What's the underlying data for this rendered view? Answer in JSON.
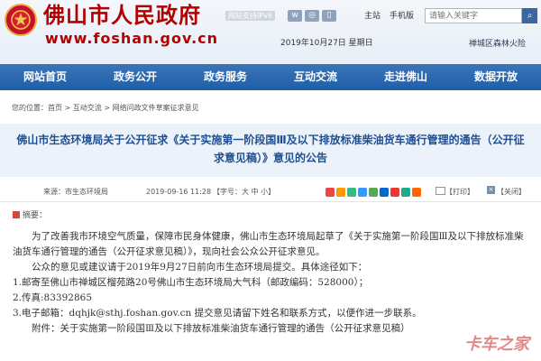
{
  "header": {
    "site_title": "佛山市人民政府",
    "site_domain": "www.foshan.gov.cn",
    "ipv6_badge": "网站支持IPv6",
    "links": [
      "主站",
      "手机版"
    ],
    "search_placeholder": "请输入关键字",
    "date": "2019年10月27日 星期日",
    "weather": "禅城区森林火险",
    "icon_names": [
      "emblem-icon",
      "weibo-icon",
      "wechat-icon",
      "app-icon",
      "search-icon"
    ]
  },
  "nav": {
    "items": [
      "网站首页",
      "政务公开",
      "政务服务",
      "互动交流",
      "走进佛山",
      "数据开放"
    ]
  },
  "breadcrumb": {
    "prefix": "您的位置：",
    "items": [
      "首页",
      "互动交流",
      "网络问政文件草案征求意见"
    ]
  },
  "article": {
    "title": "佛山市生态环境局关于公开征求《关于实施第一阶段国Ⅲ及以下排放标准柴油货车通行管理的通告（公开征求意见稿）》意见的公告",
    "meta": {
      "source": "来源：市生态环境局",
      "date": "2019-09-16 11:28",
      "font_size": "【字号：大  中  小】",
      "print": "【打印】",
      "close": "【关闭】"
    },
    "summary_label": "摘要：",
    "paragraphs": [
      "为了改善我市环境空气质量，保障市民身体健康，佛山市生态环境局起草了《关于实施第一阶段国Ⅲ及以下排放标准柴油货车通行管理的通告（公开征求意见稿）》，现向社会公众公开征求意见。",
      "公众的意见或建议请于2019年9月27日前向市生态环境局提交。具体途径如下：",
      "1.邮寄至佛山市禅城区榴苑路20号佛山市生态环境局大气科（邮政编码：528000）；",
      "2.传真:83392865",
      "3.电子邮箱：dqhjk@sthj.foshan.gov.cn    提交意见请留下姓名和联系方式，以便作进一步联系。",
      "附件：关于实施第一阶段国Ⅲ及以下排放标准柴油货车通行管理的通告（公开征求意见稿）"
    ]
  },
  "colors": {
    "title_red": "#b30000",
    "nav_blue": "#2b68b0",
    "title_blue": "#1f4f92"
  },
  "watermark": "卡车之家"
}
